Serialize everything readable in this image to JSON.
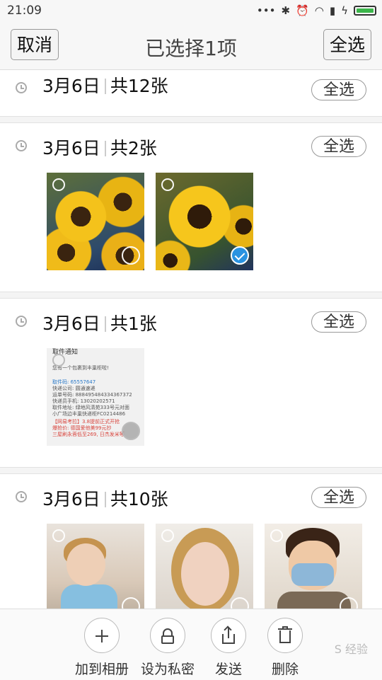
{
  "status_bar": {
    "time": "21:09"
  },
  "header": {
    "cancel_label": "取消",
    "title": "已选择1项",
    "select_all_label": "全选"
  },
  "sections": [
    {
      "date": "3月6日",
      "count": "共12张",
      "select_all": "全选"
    },
    {
      "date": "3月6日",
      "count": "共2张",
      "select_all": "全选"
    },
    {
      "date": "3月6日",
      "count": "共1张",
      "select_all": "全选"
    },
    {
      "date": "3月6日",
      "count": "共10张",
      "select_all": "全选"
    }
  ],
  "sms_thumb": {
    "title": "取件通知",
    "lines": [
      "您有一个包裹到丰巢柜啦!",
      "取件码: 65557647",
      "快递公司: 圆通速递",
      "运单号码: 888495484334367372",
      "快递员手机: 13020202571",
      "取件地址: 绿地风清苑333号元对面",
      "小广场边丰巢快递柜FC0214486",
      "【网易考拉】3.8提前正式开抢",
      "爆抢价: 德国爱他美99元抄",
      "三屋刷永蓉低至269, 日杰发米等"
    ]
  },
  "bottom_actions": [
    {
      "label": "加到相册",
      "icon": "plus-icon"
    },
    {
      "label": "设为私密",
      "icon": "lock-icon"
    },
    {
      "label": "发送",
      "icon": "share-icon"
    },
    {
      "label": "删除",
      "icon": "trash-icon"
    }
  ],
  "watermark": "S 经验",
  "colors": {
    "accent": "#2a93e0",
    "battery": "#3bb54a"
  }
}
